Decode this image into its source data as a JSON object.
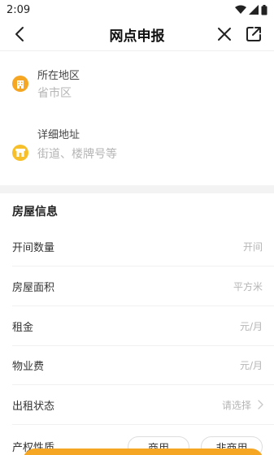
{
  "status_bar": {
    "time": "2:09"
  },
  "nav": {
    "title": "网点申报"
  },
  "address": {
    "region_label": "所在地区",
    "region_placeholder": "省市区",
    "detail_label": "详细地址",
    "detail_placeholder": "街道、楼牌号等"
  },
  "house_info": {
    "section_title": "房屋信息",
    "rows": [
      {
        "label": "开间数量",
        "value": "开间"
      },
      {
        "label": "房屋面积",
        "value": "平方米"
      },
      {
        "label": "租金",
        "value": "元/月"
      },
      {
        "label": "物业费",
        "value": "元/月"
      },
      {
        "label": "出租状态",
        "value": "请选择"
      }
    ],
    "property_label": "产权性质",
    "property_options": [
      "商用",
      "非商用"
    ]
  },
  "colors": {
    "accent": "#f5a623",
    "icon_orange": "#f5a623",
    "icon_yellow": "#f7c02b"
  },
  "icons": {
    "back": "back-arrow-icon",
    "close": "close-icon",
    "share": "share-icon",
    "region": "building-icon",
    "detail": "shop-icon"
  }
}
